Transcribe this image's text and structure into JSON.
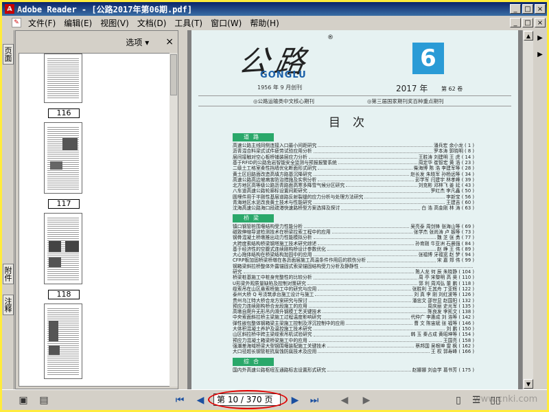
{
  "window": {
    "title": "Adobe Reader - [公路2017年第06期.pdf]",
    "min": "_",
    "max": "□",
    "close": "×"
  },
  "menu": [
    "文件(F)",
    "编辑(E)",
    "视图(V)",
    "文档(D)",
    "工具(T)",
    "窗口(W)",
    "帮助(H)"
  ],
  "sidebar_tabs": [
    "页面",
    "附件",
    "注释"
  ],
  "thumb_panel": {
    "options_label": "选项 ▾",
    "close": "×",
    "pages": [
      "116",
      "117",
      "118"
    ]
  },
  "document": {
    "logo_text": "公路",
    "logo_mark": "®",
    "brand": "GONGLU",
    "founded": "1956 年 9 月创刊",
    "issue_number": "6",
    "year": "2017 年",
    "volume": "第 62 卷",
    "pub_left": "◎公路运输类中文核心期刊",
    "pub_right": "◎第三届国家期刊奖百种重点期刊",
    "toc_title": "目次",
    "sections": [
      {
        "name": "道路",
        "entries": [
          {
            "t": "高速公路主线同侧连接入口最小间距研究",
            "a": "潘兵宏  余小龙 ( 1 )"
          },
          {
            "t": "沥青混合料梁式试件疲劳试验应用分析",
            "a": "罗本涛  郭晓明 ( 8 )"
          },
          {
            "t": "层间接触对空心板桥铺装层应力分析",
            "a": "王胜涛  刘建明  王  虎 ( 14 )"
          },
          {
            "t": "基于RFID的公路危岩智能安全监测与预报报警系统",
            "a": "周定华  崔智宏  黄  浩 ( 23 )"
          },
          {
            "t": "二级土工格室柔性挡墙优化断面形式研究",
            "a": "柴海博  陈  浩  李建军等 ( 28 )"
          },
          {
            "t": "黄土区旧路面改造高填方路基沉降研究",
            "a": "赵长发  朱晓军  孙杨远等 ( 34 )"
          },
          {
            "t": "高速公路高边坡病害防治措施及实例分析",
            "a": "彭学军  闫建宇  林孝峰 ( 39 )"
          },
          {
            "t": "北方地区高等级公路沥青路面高寒多降雪气候分区研究",
            "a": "刘克彬  邓林飞  姜  延 ( 43 )"
          },
          {
            "t": "八车道高速公路轮廓标设置间距研究",
            "a": "罗红杰  李凡鑫 ( 50 )"
          },
          {
            "t": "圆埋件用于半刚性基层道路反射裂缝的应力分析与处理方法研究",
            "a": "李新宝 ( 56 )"
          },
          {
            "t": "青海地区水泥改良黄土技术与性能研究",
            "a": "王建吉 ( 60 )"
          },
          {
            "t": "沈海高速公路海口段疏港快速路桥型方案选择及探讨",
            "a": "白  浩  高金刚  林  涛 ( 63 )"
          }
        ]
      },
      {
        "name": "桥梁",
        "entries": [
          {
            "t": "镇口钢管桩围堰结构受力性能分析",
            "a": "吴亮泰  周剑锋  张海山等 ( 69 )"
          },
          {
            "t": "磁致伸缩导波检测技术在桥梁拉索工程中的应用",
            "a": "张学杰  张尚涛  卢  振等 ( 73 )"
          },
          {
            "t": "钢骨混凝土桥墩推出动力性能模拟分析",
            "a": "魏  芝  张  勇 ( 77 )"
          },
          {
            "t": "大跨度索结构桥梁钢塔施工技术研究综述",
            "a": "孙育刚  牛亚洲  石晨强 ( 84 )"
          },
          {
            "t": "基于经济性的空腹式连续刚构桥设计参数优化",
            "a": "赵  峥  王  伟 ( 89 )"
          },
          {
            "t": "大心拖体结构在桥梁结构加固中的应用",
            "a": "张福博  牙福宽  赵  梦 ( 94 )"
          },
          {
            "t": "CFRP板加固桥梁桥墩在各沥面层施工高温条件作用后的损伤分析",
            "a": "宋  嘉  郑  伟 ( 99 )"
          },
          {
            "t": "钢箱梁斜拉桥整体外露锚固式索梁锚固结构受力分析及静静性",
            "a": ""
          },
          {
            "t": "研究",
            "a": "陈人龙  何  辰  朱晓静 ( 104 )"
          },
          {
            "t": "桥梁桩基施工中桩身完整性的比较分析",
            "a": "周  亭  宋黎明  高  昊 ( 110 )"
          },
          {
            "t": "U形梁外观质量缺陷及控制对策研究",
            "a": "郭  利  周鸿弘  董  鹏 ( 118 )"
          },
          {
            "t": "缆索吊在山区悬索桥施工中的研究与应用",
            "a": "张胜利  王其舟  丁亚辉 ( 122 )"
          },
          {
            "t": "泰州大桥 Q 号浇筑承台施工设计与施工",
            "a": "刘  真  李  刚  刘红波等 ( 126 )"
          },
          {
            "t": "贵州乌江特大桥合龙方案研究与探讨",
            "a": "潘忠文  邵世显  赵国阳 ( 132 )"
          },
          {
            "t": "预应力连续刚构桥合龙段施工的应用",
            "a": "周庆丽  史光军 ( 135 )"
          },
          {
            "t": "高墩自爬升无形吊内滑升钢模工艺关键技术",
            "a": "陈良发  李凯文 ( 138 )"
          },
          {
            "t": "中央索面斜拉桥主梁施工过程温度影响研究",
            "a": "代仲广  李惠成  刘  浩等 ( 142 )"
          },
          {
            "t": "弹性嵌包整体钢箱梁主梁施工控制及浮沉控制中的应用",
            "a": "曹  文  陈宙斌  张  福等 ( 146 )"
          },
          {
            "t": "大体积混凝土养护及温控施工技术研究",
            "a": "刘  鹏 ( 150 )"
          },
          {
            "t": "山区斜拉桥中跨主梁缆索吊机试验研究",
            "a": "韩  玉  秦占成  黄昭坤等 ( 154 )"
          },
          {
            "t": "预应力混凝土箱梁桥梁施工中的应用",
            "a": "王国亮 ( 158 )"
          },
          {
            "t": "强潮差海域桥梁大型钢围堰装配施工关键技术",
            "a": "蔡邦国  吴根坤  雷  枫 ( 162 )"
          },
          {
            "t": "大口径超长钢管桩抗腐蚀防腐技术及应用",
            "a": "王  权  郭寿峰 ( 166 )"
          }
        ]
      },
      {
        "name": "综合",
        "entries": [
          {
            "t": "国内外高速公路枢纽互通路标志设置形式研究",
            "a": "赵娜娜  刘会学  葛书芳 ( 175 )"
          }
        ]
      }
    ]
  },
  "statusbar": {
    "page_field": "第 10 / 370 页",
    "first": "⏮",
    "prev": "◀",
    "next": "▶",
    "last": "⏭",
    "back": "◀",
    "forward": "▶"
  },
  "watermarks": [
    "中国",
    "www.cnki.com"
  ]
}
